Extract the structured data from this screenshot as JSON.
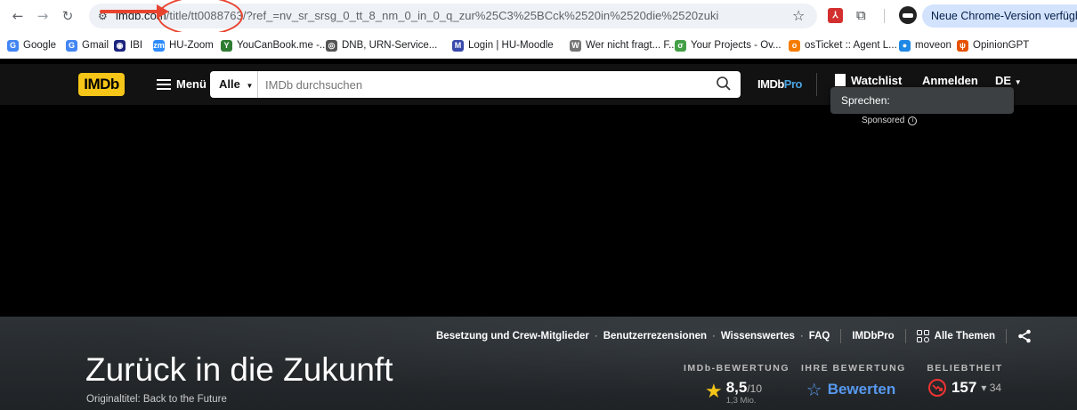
{
  "browser": {
    "url_host": "imdb.com",
    "url_path": "/title/tt0088763/?ref_=nv_sr_srsg_0_tt_8_nm_0_in_0_q_zur%25C3%25BCck%2520in%2520die%2520zuki",
    "update_label": "Neue Chrome-Version verfügbar"
  },
  "bookmarks": [
    {
      "label": "Google",
      "color": "#4285f4",
      "glyph": "G"
    },
    {
      "label": "Gmail",
      "color": "#4285f4",
      "glyph": "G"
    },
    {
      "label": "IBI",
      "color": "#1a237e",
      "glyph": "◉"
    },
    {
      "label": "HU-Zoom",
      "color": "#2d8cff",
      "glyph": "zm"
    },
    {
      "label": "YouCanBook.me -...",
      "color": "#2e7d32",
      "glyph": "Y"
    },
    {
      "label": "DNB, URN-Service...",
      "color": "#555555",
      "glyph": "◎"
    },
    {
      "label": "Login | HU-Moodle",
      "color": "#3949ab",
      "glyph": "M"
    },
    {
      "label": "Wer nicht fragt... F...",
      "color": "#757575",
      "glyph": "W"
    },
    {
      "label": "Your Projects - Ov...",
      "color": "#43a047",
      "glyph": "σ"
    },
    {
      "label": "osTicket :: Agent L...",
      "color": "#f57c00",
      "glyph": "o"
    },
    {
      "label": "moveon",
      "color": "#1e88e5",
      "glyph": "●"
    },
    {
      "label": "OpinionGPT",
      "color": "#e65100",
      "glyph": "ψ"
    }
  ],
  "imdb": {
    "logo": "IMDb",
    "menu": "Menü",
    "search_category": "Alle",
    "search_placeholder": "IMDb durchsuchen",
    "pro_a": "IMDb",
    "pro_b": "Pro",
    "watchlist": "Watchlist",
    "signin": "Anmelden",
    "lang": "DE"
  },
  "tooltip": "Sprechen:",
  "sponsored": "Sponsored",
  "subnav": {
    "cast": "Besetzung und Crew-Mitglieder",
    "reviews": "Benutzerrezensionen",
    "trivia": "Wissenswertes",
    "faq": "FAQ",
    "pro": "IMDbPro",
    "themes": "Alle Themen"
  },
  "movie": {
    "title": "Zurück in die Zukunft",
    "original_title": "Originaltitel: Back to the Future"
  },
  "ratings": {
    "imdb_label": "IMDb-BEWERTUNG",
    "imdb_score": "8,5",
    "imdb_outof": "/10",
    "imdb_count": "1,3 Mio.",
    "user_label": "IHRE BEWERTUNG",
    "user_action": "Bewerten",
    "pop_label": "BELIEBTHEIT",
    "pop_value": "157",
    "pop_delta": "34"
  }
}
